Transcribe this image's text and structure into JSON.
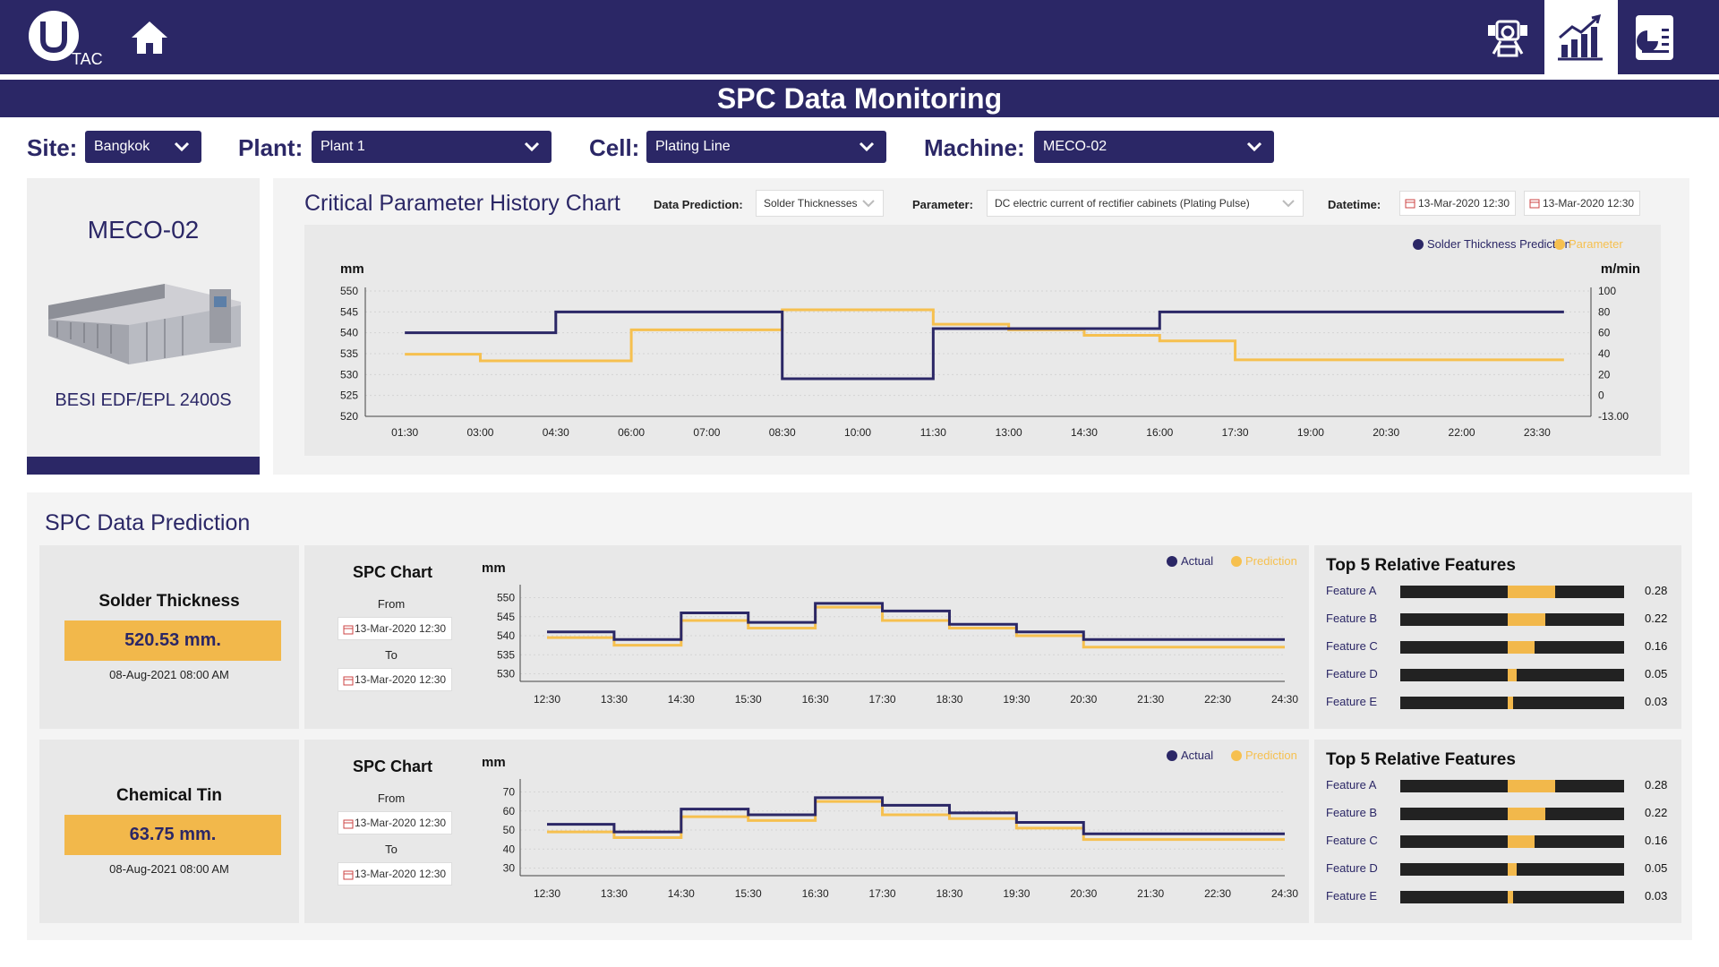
{
  "app": {
    "logo_text": "TAC",
    "title": "SPC Data Monitoring"
  },
  "nav": {
    "icons": [
      "robot-icon",
      "bar-chart-icon",
      "report-icon"
    ],
    "active": "bar-chart-icon"
  },
  "filters": {
    "site": {
      "label": "Site:",
      "value": "Bangkok"
    },
    "plant": {
      "label": "Plant:",
      "value": "Plant 1"
    },
    "cell": {
      "label": "Cell:",
      "value": "Plating Line"
    },
    "machine": {
      "label": "Machine:",
      "value": "MECO-02"
    }
  },
  "machine_panel": {
    "name": "MECO-02",
    "model": "BESI EDF/EPL 2400S"
  },
  "history": {
    "title": "Critical Parameter History Chart",
    "data_prediction_label": "Data Prediction:",
    "data_prediction_value": "Solder Thicknesses",
    "parameter_label": "Parameter:",
    "parameter_value": "DC electric current of rectifier cabinets (Plating Pulse)",
    "datetime_label": "Datetime:",
    "date_from": "13-Mar-2020 12:30",
    "date_to": "13-Mar-2020 12:30"
  },
  "prediction_section": {
    "title": "SPC Data Prediction"
  },
  "cards": [
    {
      "name": "Solder Thickness",
      "value": "520.53  mm.",
      "date": "08-Aug-2021 08:00 AM",
      "spc_title": "SPC Chart",
      "from_label": "From",
      "from_date": "13-Mar-2020 12:30",
      "to_label": "To",
      "to_date": "13-Mar-2020 12:30",
      "features_title": "Top 5 Relative Features",
      "features": [
        {
          "name": "Feature A",
          "value": "0.28",
          "frac": 0.28
        },
        {
          "name": "Feature B",
          "value": "0.22",
          "frac": 0.22
        },
        {
          "name": "Feature C",
          "value": "0.16",
          "frac": 0.16
        },
        {
          "name": "Feature D",
          "value": "0.05",
          "frac": 0.05
        },
        {
          "name": "Feature E",
          "value": "0.03",
          "frac": 0.03
        }
      ]
    },
    {
      "name": "Chemical Tin",
      "value": "63.75  mm.",
      "date": "08-Aug-2021 08:00 AM",
      "spc_title": "SPC Chart",
      "from_label": "From",
      "from_date": "13-Mar-2020 12:30",
      "to_label": "To",
      "to_date": "13-Mar-2020 12:30",
      "features_title": "Top 5 Relative Features",
      "features": [
        {
          "name": "Feature A",
          "value": "0.28",
          "frac": 0.28
        },
        {
          "name": "Feature B",
          "value": "0.22",
          "frac": 0.22
        },
        {
          "name": "Feature C",
          "value": "0.16",
          "frac": 0.16
        },
        {
          "name": "Feature D",
          "value": "0.05",
          "frac": 0.05
        },
        {
          "name": "Feature E",
          "value": "0.03",
          "frac": 0.03
        }
      ]
    }
  ],
  "colors": {
    "navy": "#2b2766",
    "gold": "#f6c04f"
  },
  "chart_data": [
    {
      "type": "line",
      "step": true,
      "x": [
        "01:30",
        "03:00",
        "04:30",
        "06:00",
        "07:00",
        "08:30",
        "10:00",
        "11:30",
        "13:00",
        "14:30",
        "16:00",
        "17:30",
        "19:00",
        "20:30",
        "22:00",
        "23:30"
      ],
      "ylabel": "mm",
      "y2label": "m/min",
      "yticks": [
        "550",
        "545",
        "540",
        "535",
        "530",
        "525",
        "520"
      ],
      "y2ticks": [
        "100",
        "80",
        "60",
        "40",
        "20",
        "0",
        "-13.00"
      ],
      "ylim": [
        520,
        550
      ],
      "y2lim": [
        -13,
        100
      ],
      "legend_position": "top-right",
      "series": [
        {
          "name": "Solder Thickness Prediction",
          "axis": "left",
          "color": "#2b2766",
          "values": [
            540,
            540,
            545,
            545,
            545,
            529,
            529,
            541,
            541,
            541,
            545,
            545,
            545,
            545,
            545,
            545
          ]
        },
        {
          "name": "Parameter",
          "axis": "right",
          "color": "#f6c04f",
          "values": [
            43,
            37,
            37,
            65,
            65,
            83,
            83,
            70,
            65,
            60,
            55,
            38,
            38,
            38,
            38,
            38
          ]
        }
      ]
    },
    {
      "type": "line",
      "step": true,
      "x": [
        "12:30",
        "13:30",
        "14:30",
        "15:30",
        "16:30",
        "17:30",
        "18:30",
        "19:30",
        "20:30",
        "21:30",
        "22:30",
        "24:30"
      ],
      "ylabel": "mm",
      "yticks": [
        "550",
        "545",
        "540",
        "535",
        "530"
      ],
      "ylim": [
        528,
        552
      ],
      "legend_position": "top-right",
      "series": [
        {
          "name": "Actual",
          "color": "#2b2766",
          "values": [
            541,
            539,
            546,
            543.5,
            548.5,
            546.5,
            543,
            541,
            539,
            539,
            539
          ]
        },
        {
          "name": "Prediction",
          "color": "#f6c04f",
          "values": [
            539.5,
            537.5,
            544,
            542,
            547.5,
            544,
            542,
            540,
            537,
            537,
            537
          ]
        }
      ]
    },
    {
      "type": "line",
      "step": true,
      "x": [
        "12:30",
        "13:30",
        "14:30",
        "15:30",
        "16:30",
        "17:30",
        "18:30",
        "19:30",
        "20:30",
        "21:30",
        "22:30",
        "24:30"
      ],
      "ylabel": "mm",
      "yticks": [
        "70",
        "60",
        "50",
        "40",
        "30"
      ],
      "ylim": [
        26,
        74
      ],
      "legend_position": "top-right",
      "series": [
        {
          "name": "Actual",
          "color": "#2b2766",
          "values": [
            53,
            49,
            61,
            58,
            67,
            63,
            59,
            54,
            48,
            48,
            48
          ]
        },
        {
          "name": "Prediction",
          "color": "#f6c04f",
          "values": [
            49,
            46,
            57,
            55,
            65,
            58,
            56,
            51,
            45,
            45,
            45
          ]
        }
      ]
    }
  ]
}
